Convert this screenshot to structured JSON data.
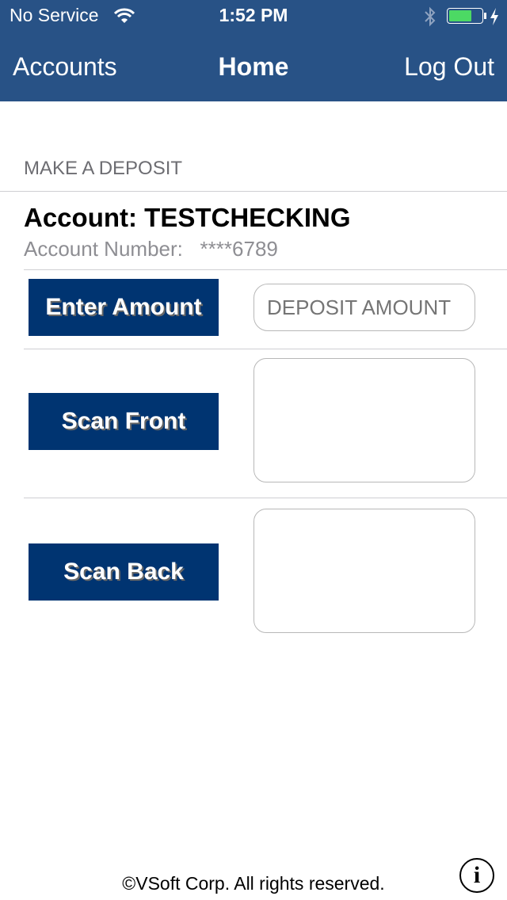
{
  "status_bar": {
    "carrier": "No Service",
    "time": "1:52 PM",
    "battery_color": "#4cd964",
    "icons": [
      "wifi-icon",
      "bluetooth-icon",
      "battery-icon",
      "charging-icon"
    ]
  },
  "nav": {
    "left": "Accounts",
    "title": "Home",
    "right": "Log Out",
    "color": "#285286"
  },
  "section_title": "MAKE A DEPOSIT",
  "account": {
    "name": "Account: TESTCHECKING",
    "number_label": "Account Number:",
    "number": "****6789"
  },
  "buttons": {
    "enter_amount": "Enter Amount",
    "scan_front": "Scan Front",
    "scan_back": "Scan Back",
    "color": "#003471"
  },
  "amount_input": {
    "placeholder": "DEPOSIT AMOUNT",
    "value": ""
  },
  "footer": {
    "copyright": "©VSoft Corp. All rights reserved.",
    "info_icon": "info-icon"
  }
}
